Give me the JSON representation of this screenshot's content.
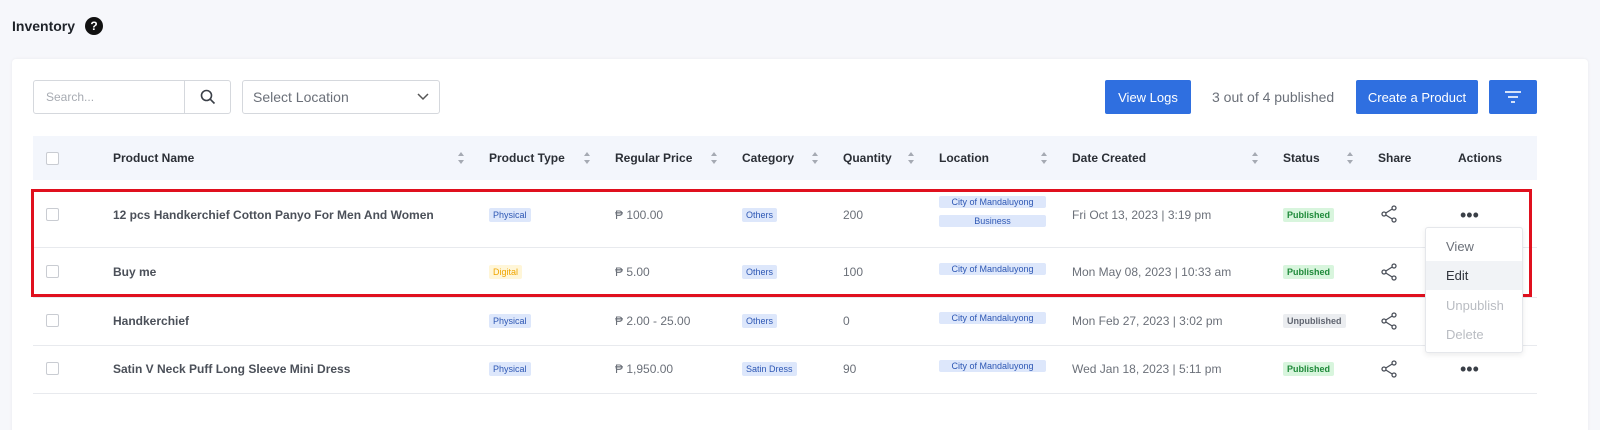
{
  "page": {
    "title": "Inventory",
    "help_icon": "question-circle-icon"
  },
  "toolbar": {
    "search_placeholder": "Search...",
    "location_placeholder": "Select Location",
    "view_logs_label": "View Logs",
    "publish_count": "3 out of 4 published",
    "create_label": "Create a Product",
    "accent_color": "#2f6fe0"
  },
  "table": {
    "columns": [
      "Product Name",
      "Product Type",
      "Regular Price",
      "Category",
      "Quantity",
      "Location",
      "Date Created",
      "Status",
      "Share",
      "Actions"
    ],
    "rows": [
      {
        "name": "12 pcs Handkerchief Cotton Panyo For Men And Women",
        "type": "Physical",
        "price": "₱ 100.00",
        "category": "Others",
        "quantity": "200",
        "locations": [
          "City of Mandaluyong",
          "Business"
        ],
        "date": "Fri Oct 13, 2023 | 3:19 pm",
        "status": "Published"
      },
      {
        "name": "Buy me",
        "type": "Digital",
        "price": "₱ 5.00",
        "category": "Others",
        "quantity": "100",
        "locations": [
          "City of Mandaluyong"
        ],
        "date": "Mon May 08, 2023 | 10:33 am",
        "status": "Published"
      },
      {
        "name": "Handkerchief",
        "type": "Physical",
        "price": "₱ 2.00 - 25.00",
        "category": "Others",
        "quantity": "0",
        "locations": [
          "City of Mandaluyong"
        ],
        "date": "Mon Feb 27, 2023 | 3:02 pm",
        "status": "Unpublished"
      },
      {
        "name": "Satin V Neck Puff Long Sleeve Mini Dress",
        "type": "Physical",
        "price": "₱ 1,950.00",
        "category": "Satin Dress",
        "quantity": "90",
        "locations": [
          "City of Mandaluyong"
        ],
        "date": "Wed Jan 18, 2023 | 5:11 pm",
        "status": "Published"
      }
    ]
  },
  "action_menu": {
    "items": [
      "View",
      "Edit",
      "Unpublish",
      "Delete"
    ],
    "active": "Edit"
  },
  "highlight_color": "#e0101e"
}
